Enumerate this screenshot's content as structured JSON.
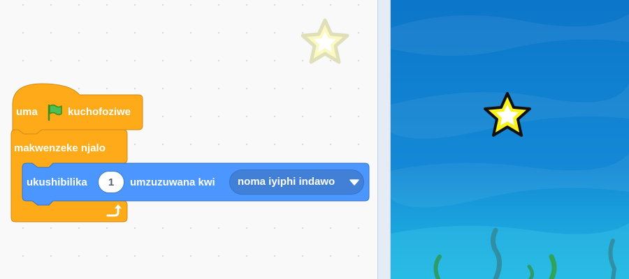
{
  "code_area": {
    "hat_block": {
      "prefix": "uma",
      "flag_icon": "green-flag-icon",
      "suffix": "kuchofoziwe"
    },
    "forever_block": {
      "label": "makwenzeke njalo",
      "loop_icon": "loop-arrow-icon"
    },
    "glide_block": {
      "label_before": "ukushibilika",
      "seconds_value": "1",
      "label_after": "umzuzuwana kwi",
      "target_dropdown": "noma iyiphi indawo"
    },
    "ghost_sprite_icon": "star-icon"
  },
  "stage": {
    "sprite_icon": "star-icon",
    "backdrop": "underwater"
  },
  "colors": {
    "control_orange": "#ffab19",
    "control_border": "#cf8b17",
    "motion_blue": "#4c97ff",
    "motion_border": "#3373cc",
    "star_yellow": "#f9f31a",
    "stage_blue": "#0c76c9"
  }
}
